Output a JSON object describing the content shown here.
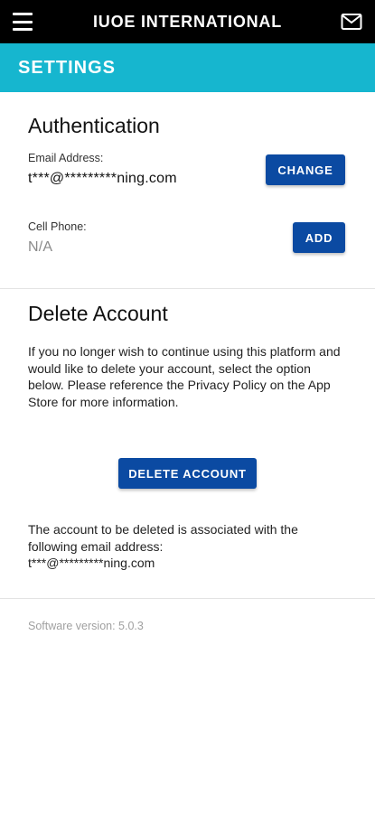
{
  "header": {
    "title": "IUOE INTERNATIONAL",
    "menu_icon": "hamburger-menu-icon",
    "mail_icon": "envelope-icon"
  },
  "settings_bar": {
    "label": "SETTINGS"
  },
  "authentication": {
    "title": "Authentication",
    "email_label": "Email Address:",
    "email_value": "t***@*********ning.com",
    "change_button": "CHANGE",
    "phone_label": "Cell Phone:",
    "phone_value": "N/A",
    "add_button": "ADD"
  },
  "delete_account": {
    "title": "Delete Account",
    "description": "If you no longer wish to continue using this platform and would like to delete your account, select the option below. Please reference the Privacy Policy on the App Store for more information.",
    "button": "DELETE ACCOUNT",
    "note": "The account to be deleted is associated with the following email address:",
    "email": "t***@*********ning.com"
  },
  "footer": {
    "software_version": "Software version: 5.0.3"
  },
  "colors": {
    "header_bg": "#000000",
    "settings_bar_bg": "#16b6cf",
    "button_bg": "#0b4aa2"
  }
}
